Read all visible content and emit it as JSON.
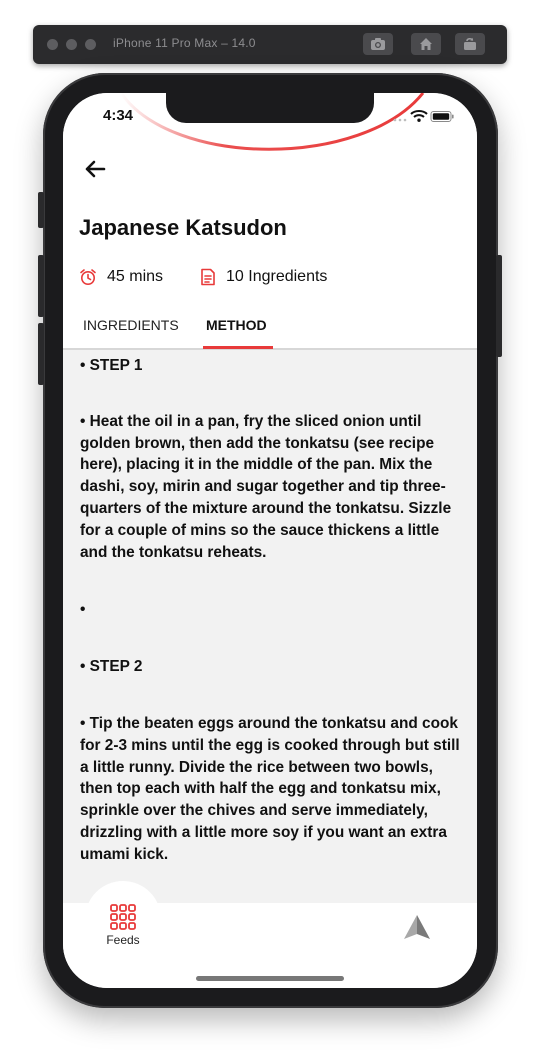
{
  "simulator": {
    "title": "iPhone 11 Pro Max – 14.0"
  },
  "status_bar": {
    "time": "4:34"
  },
  "recipe": {
    "title": "Japanese Katsudon",
    "duration": "45 mins",
    "ingredients_count": "10 Ingredients"
  },
  "tabs": [
    {
      "label": "INGREDIENTS",
      "active": false
    },
    {
      "label": "METHOD",
      "active": true
    }
  ],
  "method": {
    "steps": [
      {
        "text": "• STEP 1"
      },
      {
        "text": "• Heat the oil in a pan, fry the sliced onion until golden brown, then add the tonkatsu (see recipe here), placing it in the middle of the pan. Mix the dashi, soy, mirin and sugar together and tip three-quarters of the mixture around the tonkatsu. Sizzle for a couple of mins so the sauce thickens a little and the tonkatsu reheats."
      },
      {
        "text": "•"
      },
      {
        "text": "• STEP 2"
      },
      {
        "text": "• Tip the beaten eggs around the tonkatsu and cook for 2-3 mins until the egg is cooked through but still a little runny. Divide the rice between two bowls, then top each with half the egg and tonkatsu mix, sprinkle over the chives and serve immediately, drizzling with a little more soy if you want an extra umami kick."
      }
    ]
  },
  "bottom_nav": {
    "feeds_label": "Feeds"
  },
  "icons": {
    "back": "arrow-left-icon",
    "timer": "alarm-clock-icon",
    "ingredients": "document-list-icon",
    "feeds": "grid-icon",
    "send": "paper-plane-icon"
  },
  "colors": {
    "accent": "#e83a3a",
    "screen_bg": "#f2f2f2",
    "text": "#111111"
  }
}
